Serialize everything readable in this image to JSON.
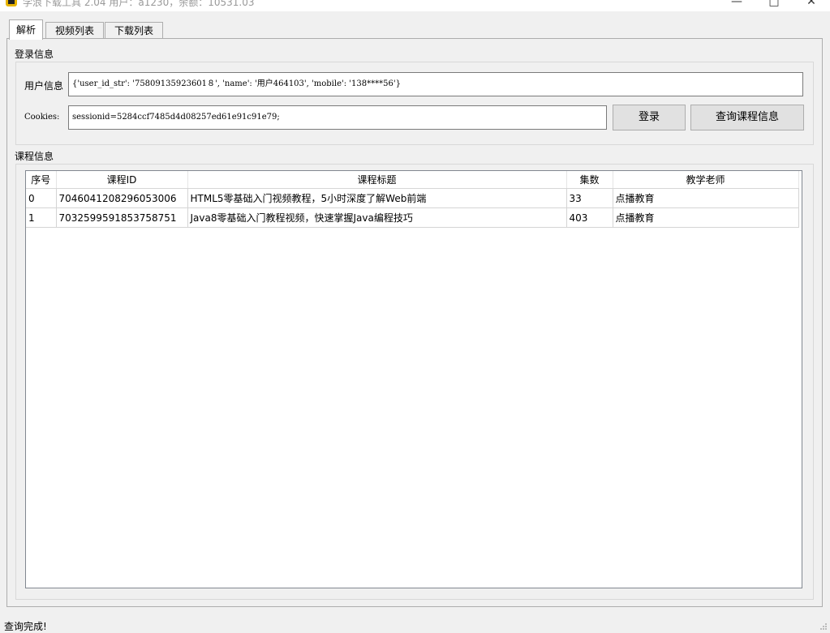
{
  "window": {
    "title": "学浪下载工具 2.04 用户：a1230，余额：10531.03"
  },
  "tabs": [
    {
      "label": "解析"
    },
    {
      "label": "视频列表"
    },
    {
      "label": "下载列表"
    }
  ],
  "login": {
    "group_title": "登录信息",
    "user_info_label": "用户信息",
    "user_info_value": "{'user_id_str': '75809135923601８', 'name': '用户464103', 'mobile': '138****56'}",
    "cookies_label": "Cookies:",
    "cookies_value": "sessionid=5284ccf7485d4d08257ed61e91c91e79;",
    "login_button": "登录",
    "query_button": "查询课程信息"
  },
  "course": {
    "group_title": "课程信息",
    "columns": [
      "序号",
      "课程ID",
      "课程标题",
      "集数",
      "教学老师"
    ],
    "rows": [
      [
        "0",
        "7046041208296053006",
        "HTML5零基础入门视频教程，5小时深度了解Web前端",
        "33",
        "点播教育"
      ],
      [
        "1",
        "7032599591853758751",
        "Java8零基础入门教程视频，快速掌握Java编程技巧",
        "403",
        "点播教育"
      ]
    ]
  },
  "status": {
    "text": "查询完成!"
  },
  "colors": {
    "window_bg": "#f0f0f0",
    "field_border": "#7a7a7a",
    "button_bg": "#e1e1e1"
  }
}
